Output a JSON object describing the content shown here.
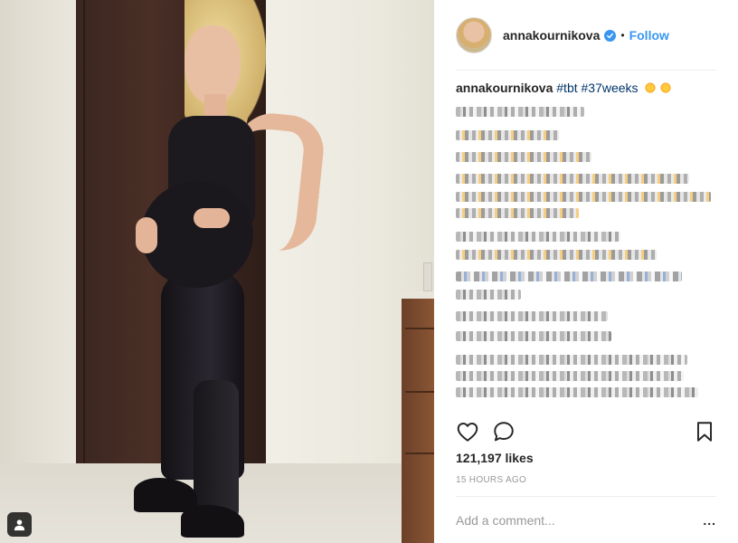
{
  "post": {
    "photo_icon": "user-tag-icon"
  },
  "header": {
    "username": "annakournikova",
    "verified_icon": "verified-badge-icon",
    "separator": "•",
    "follow_label": "Follow"
  },
  "caption": {
    "username": "annakournikova",
    "hashtags": [
      "#tbt",
      "#37weeks"
    ]
  },
  "actions": {
    "like_icon": "heart-icon",
    "comment_icon": "comment-icon",
    "save_icon": "bookmark-icon"
  },
  "likes_label": "121,197 likes",
  "time_ago": "15 HOURS AGO",
  "comment": {
    "placeholder": "Add a comment...",
    "more_label": "..."
  },
  "colors": {
    "accent": "#3897f0",
    "hashtag": "#003569",
    "text": "#262626",
    "muted": "#999999"
  }
}
